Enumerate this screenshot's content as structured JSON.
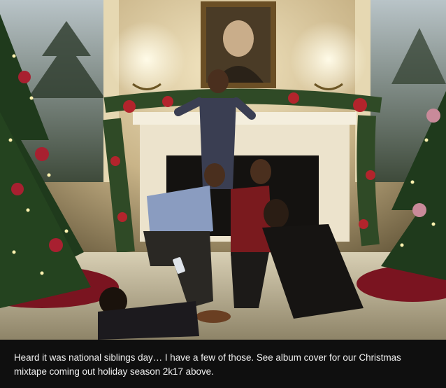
{
  "photo": {
    "description_icon": "photo-image",
    "palette": {
      "wall": "#d9c79e",
      "garland": "#2f4a26",
      "tree_lights": "#fff3b0",
      "rug": "#b7a98a",
      "tree_skirt": "#7a1420"
    }
  },
  "caption": {
    "text": "Heard it was national siblings day… I have a few of those. See album cover for our Christmas mixtape coming out holiday season 2k17 above."
  }
}
